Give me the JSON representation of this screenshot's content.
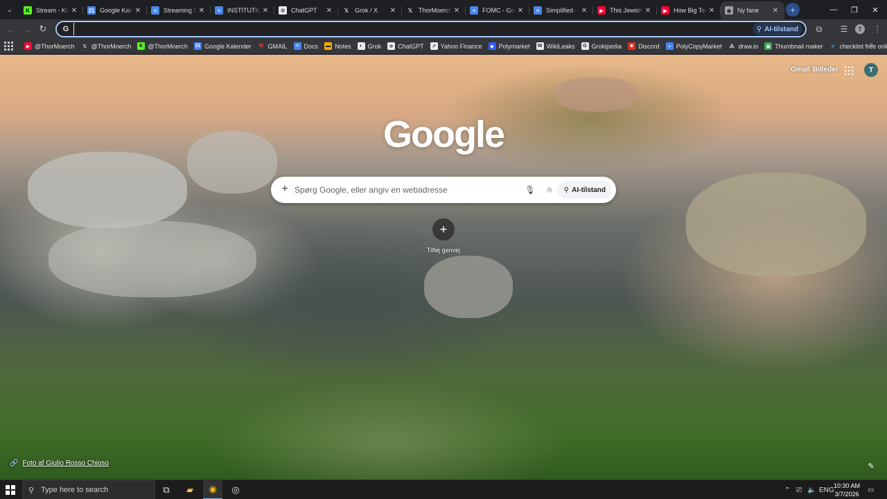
{
  "browser": {
    "tabs": [
      {
        "title": "Stream - Kick",
        "favicon": "kick-icon",
        "fav_color": "#53fc18",
        "fav_text": "K",
        "fav_fg": "#000000"
      },
      {
        "title": "Google Kalender",
        "favicon": "calendar-icon",
        "fav_color": "#4285f4",
        "fav_text": "31",
        "fav_fg": "#ffffff"
      },
      {
        "title": "Streaming Dashboard",
        "favicon": "docs-icon",
        "fav_color": "#4a86e8",
        "fav_text": "≡",
        "fav_fg": "#ffffff"
      },
      {
        "title": "INSTITUTIONAL",
        "favicon": "docs-icon",
        "fav_color": "#4a86e8",
        "fav_text": "≡",
        "fav_fg": "#ffffff"
      },
      {
        "title": "ChatGPT",
        "favicon": "chatgpt-icon",
        "fav_color": "#e8eaed",
        "fav_text": "✲",
        "fav_fg": "#202124"
      },
      {
        "title": "Grok / X",
        "favicon": "x-icon",
        "fav_color": "#1e1f22",
        "fav_text": "𝕏",
        "fav_fg": "#ffffff"
      },
      {
        "title": "ThorMoerch",
        "favicon": "x-icon",
        "fav_color": "#1e1f22",
        "fav_text": "𝕏",
        "fav_fg": "#ffffff"
      },
      {
        "title": "FOMC - Google",
        "favicon": "docs-icon",
        "fav_color": "#4a86e8",
        "fav_text": "≡",
        "fav_fg": "#ffffff"
      },
      {
        "title": "Simplified - G",
        "favicon": "docs-icon",
        "fav_color": "#4a86e8",
        "fav_text": "≡",
        "fav_fg": "#ffffff"
      },
      {
        "title": "This Jewish Fa",
        "favicon": "youtube-icon",
        "fav_color": "#ff0033",
        "fav_text": "▶",
        "fav_fg": "#ffffff"
      },
      {
        "title": "How Big Tech",
        "favicon": "youtube-icon",
        "fav_color": "#ff0033",
        "fav_text": "▶",
        "fav_fg": "#ffffff"
      },
      {
        "title": "Ny fane",
        "favicon": "chrome-icon",
        "fav_color": "#9aa0a6",
        "fav_text": "◉",
        "fav_fg": "#202124",
        "active": true
      }
    ],
    "new_tab_label": "+",
    "omnibox": {
      "value": "",
      "placeholder": "",
      "ai_mode_label": "AI-tilstand"
    },
    "profile_initial": "T"
  },
  "bookmarks": [
    {
      "label": "@ThorMoerch",
      "icon": "youtube-icon",
      "color": "#ff0033",
      "glyph": "▶",
      "fg": "#ffffff"
    },
    {
      "label": "@ThorMoerch",
      "icon": "x-icon",
      "color": "#35363a",
      "glyph": "𝕏",
      "fg": "#ffffff"
    },
    {
      "label": "@ThorMoerch",
      "icon": "kick-icon",
      "color": "#53fc18",
      "glyph": "K",
      "fg": "#000000"
    },
    {
      "label": "Google Kalender",
      "icon": "calendar-icon",
      "color": "#4285f4",
      "glyph": "31",
      "fg": "#ffffff"
    },
    {
      "label": "GMAIL",
      "icon": "gmail-icon",
      "color": "#35363a",
      "glyph": "M",
      "fg": "#ea4335"
    },
    {
      "label": "Docs",
      "icon": "docs-icon",
      "color": "#4a86e8",
      "glyph": "≡",
      "fg": "#ffffff"
    },
    {
      "label": "Notes",
      "icon": "notes-icon",
      "color": "#f9ab00",
      "glyph": "▬",
      "fg": "#202124"
    },
    {
      "label": "Grok",
      "icon": "grok-icon",
      "color": "#e8eaed",
      "glyph": "◐",
      "fg": "#202124"
    },
    {
      "label": "ChatGPT",
      "icon": "chatgpt-icon",
      "color": "#e8eaed",
      "glyph": "✲",
      "fg": "#202124"
    },
    {
      "label": "Yahoo Finance",
      "icon": "yahoo-finance-icon",
      "color": "#e8eaed",
      "glyph": "↗",
      "fg": "#202124"
    },
    {
      "label": "Polymarket",
      "icon": "polymarket-icon",
      "color": "#2e5cff",
      "glyph": "◆",
      "fg": "#ffffff"
    },
    {
      "label": "WikiLeaks",
      "icon": "wikileaks-icon",
      "color": "#e8eaed",
      "glyph": "W",
      "fg": "#202124"
    },
    {
      "label": "Grokipedia",
      "icon": "grokipedia-icon",
      "color": "#e8eaed",
      "glyph": "G",
      "fg": "#202124"
    },
    {
      "label": "Discord",
      "icon": "discord-icon",
      "color": "#d93025",
      "glyph": "☻",
      "fg": "#ffffff"
    },
    {
      "label": "PolyCopyMarket",
      "icon": "polycopy-icon",
      "color": "#4285f4",
      "glyph": "◒",
      "fg": "#ffffff"
    },
    {
      "label": "draw.io",
      "icon": "drawio-icon",
      "color": "#35363a",
      "glyph": "⁂",
      "fg": "#e8eaed"
    },
    {
      "label": "Thumbnail maker",
      "icon": "thumbnail-icon",
      "color": "#34a853",
      "glyph": "▣",
      "fg": "#ffffff"
    },
    {
      "label": "checklist free online",
      "icon": "checklist-icon",
      "color": "#35363a",
      "glyph": "✔",
      "fg": "#4fc3f7"
    }
  ],
  "ntp": {
    "gmail_link": "Gmail",
    "images_link": "Billeder",
    "avatar_initial": "T",
    "logo_text": "Google",
    "search_placeholder": "Spørg Google, eller angiv en webadresse",
    "ai_mode_label": "AI-tilstand",
    "add_shortcut_label": "Tilføj genvej",
    "photo_credit": "Foto af Giulio Rosso Chioso"
  },
  "taskbar": {
    "search_placeholder": "Type here to search",
    "language": "ENG",
    "time": "10:30 AM",
    "date": "3/7/2026"
  }
}
